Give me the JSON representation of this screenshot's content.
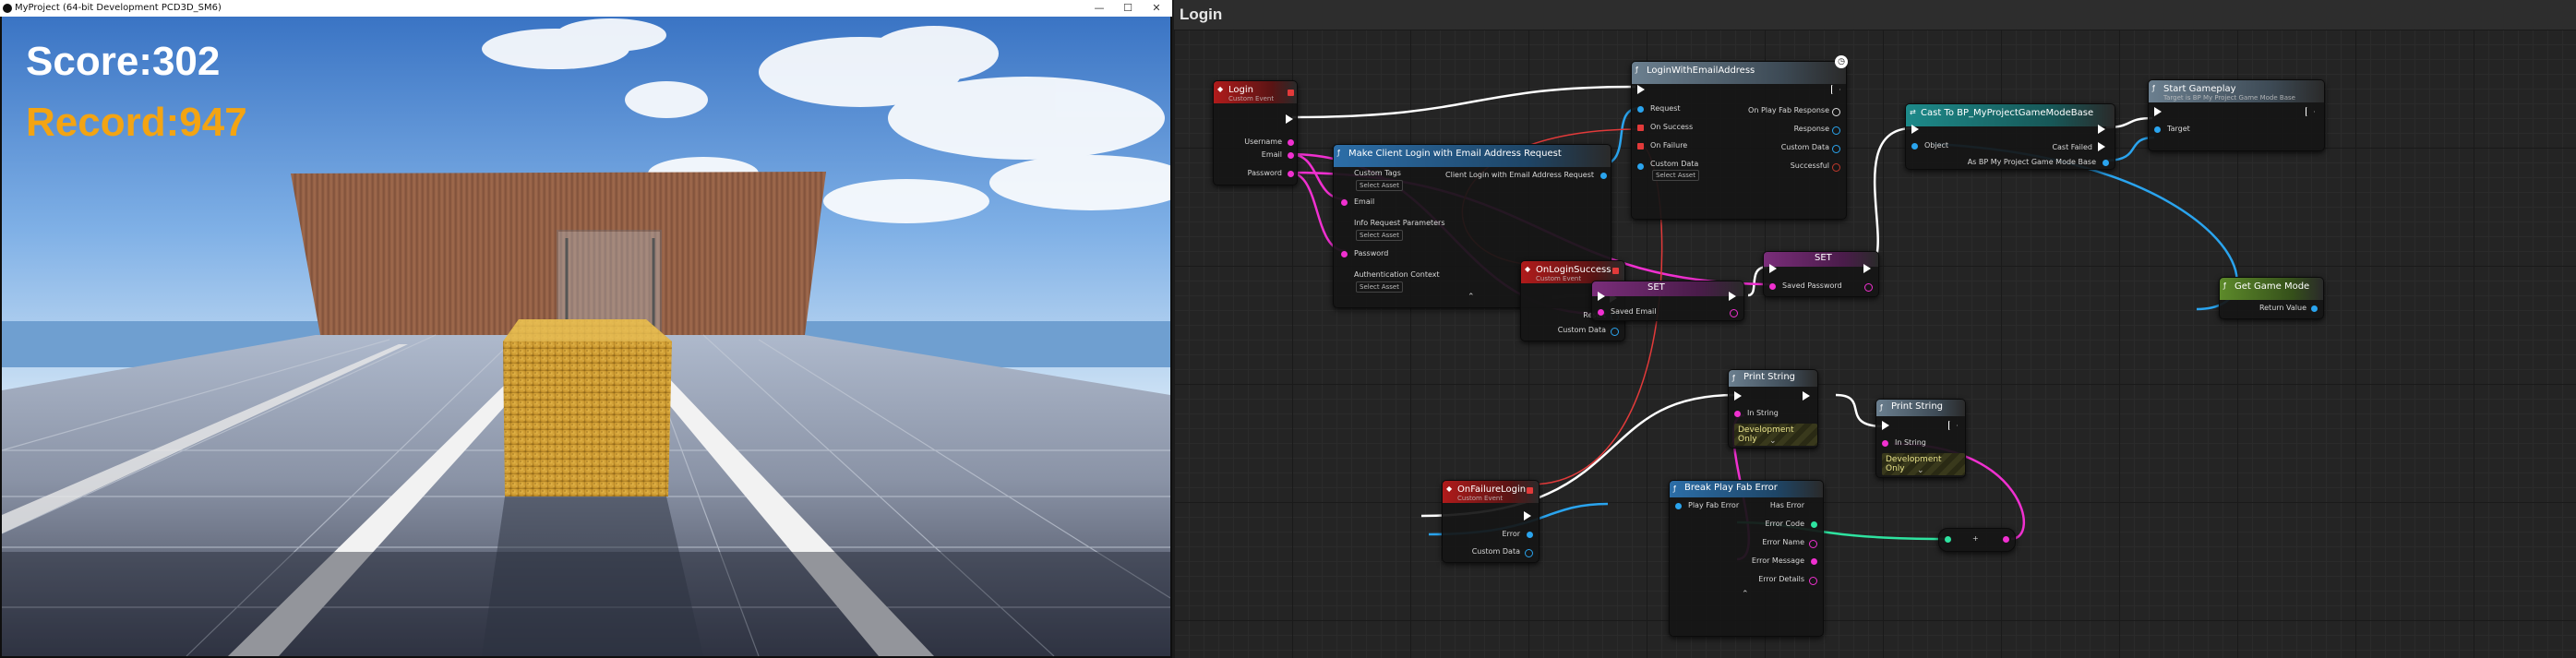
{
  "game_window": {
    "title": "MyProject (64-bit Development PCD3D_SM6)",
    "controls": {
      "minimize": "—",
      "maximize": "☐",
      "close": "✕"
    },
    "hud": {
      "score": "Score:302",
      "record": "Record:947"
    },
    "colors": {
      "score": "#ffffff",
      "record": "#f3a413"
    }
  },
  "blueprint": {
    "tab_title": "Login",
    "nodes": {
      "login_event": {
        "title": "Login",
        "subtitle": "Custom Event",
        "pins": [
          "Username",
          "Email",
          "Password"
        ]
      },
      "make_request": {
        "title": "Make Client Login with Email Address Request",
        "output": "Client Login with Email Address Request",
        "pins": [
          "Custom Tags",
          "Email",
          "Info Request Parameters",
          "Password",
          "Authentication Context"
        ],
        "select_asset": "Select Asset"
      },
      "login_with_email": {
        "title": "LoginWithEmailAddress",
        "inputs": [
          "Request",
          "On Success",
          "On Failure",
          "Custom Data"
        ],
        "outputs": [
          "On Play Fab Response",
          "Response",
          "Custom Data",
          "Successful"
        ],
        "select_asset": "Select Asset"
      },
      "cast_node": {
        "title": "Cast To BP_MyProjectGameModeBase",
        "pins": [
          "Object",
          "Cast Failed",
          "As BP My Project Game Mode Base"
        ]
      },
      "start_gameplay": {
        "title": "Start Gameplay",
        "subtitle": "Target is BP My Project Game Mode Base",
        "pins": [
          "Target"
        ]
      },
      "get_game_mode": {
        "title": "Get Game Mode",
        "pins": [
          "Return Value"
        ]
      },
      "on_login_success": {
        "title": "OnLoginSuccess",
        "subtitle": "Custom Event",
        "pins": [
          "Result",
          "Custom Data"
        ]
      },
      "set_email": {
        "title": "SET",
        "pins": [
          "Saved Email"
        ]
      },
      "set_password": {
        "title": "SET",
        "pins": [
          "Saved Password"
        ]
      },
      "print_string_1": {
        "title": "Print String",
        "pins": [
          "In String"
        ],
        "badge": "Development Only"
      },
      "print_string_2": {
        "title": "Print String",
        "pins": [
          "In String"
        ],
        "badge": "Development Only"
      },
      "on_failure_login": {
        "title": "OnFailureLogin",
        "subtitle": "Custom Event",
        "pins": [
          "Error",
          "Custom Data"
        ]
      },
      "break_error": {
        "title": "Break Play Fab Error",
        "inputs": [
          "Play Fab Error"
        ],
        "outputs": [
          "Has Error",
          "Error Code",
          "Error Name",
          "Error Message",
          "Error Details"
        ]
      },
      "append_node": {
        "title": "+"
      }
    },
    "colors": {
      "event_red": "#b01b1b",
      "function_blue": "#2c6ea8",
      "exec_white": "#ffffff",
      "string_pink": "#f030d0",
      "object_blue": "#2aa4ee",
      "int_teal": "#2ee3a0",
      "error_red": "#e23a3a",
      "grid_bg": "#242424"
    }
  }
}
